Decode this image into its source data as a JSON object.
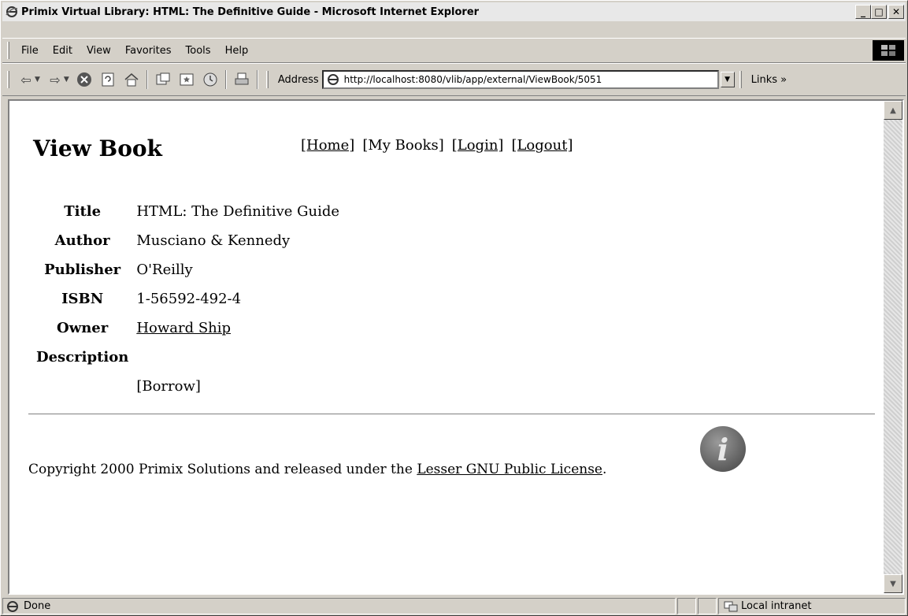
{
  "window": {
    "title": "Primix Virtual Library: HTML: The Definitive Guide - Microsoft Internet Explorer",
    "min_glyph": "_",
    "max_glyph": "□",
    "close_glyph": "✕"
  },
  "menu": [
    "File",
    "Edit",
    "View",
    "Favorites",
    "Tools",
    "Help"
  ],
  "toolbar": {
    "address_label": "Address",
    "address_value": "http://localhost:8080/vlib/app/external/ViewBook/5051",
    "links_label": "Links",
    "links_chevron": "»"
  },
  "page": {
    "heading": "View Book",
    "nav": {
      "home": "[Home]",
      "my_books": "[My Books]",
      "login": "[Login]",
      "logout": "[Logout]"
    },
    "book": {
      "title_label": "Title",
      "title_value": "HTML: The Definitive Guide",
      "author_label": "Author",
      "author_value": "Musciano & Kennedy",
      "publisher_label": "Publisher",
      "publisher_value": "O'Reilly",
      "isbn_label": "ISBN",
      "isbn_value": "1-56592-492-4",
      "owner_label": "Owner",
      "owner_value": "Howard Ship",
      "description_label": "Description",
      "description_value": "",
      "borrow": "[Borrow]"
    },
    "footer": {
      "text_before": "Copyright 2000 Primix Solutions and released under the ",
      "license_link": "Lesser GNU Public License",
      "text_after": "."
    },
    "info_icon_letter": "i"
  },
  "status": {
    "text": "Done",
    "zone": "Local intranet"
  },
  "colors": {
    "chrome": "#d4d0c8",
    "page_bg": "#ffffff"
  }
}
